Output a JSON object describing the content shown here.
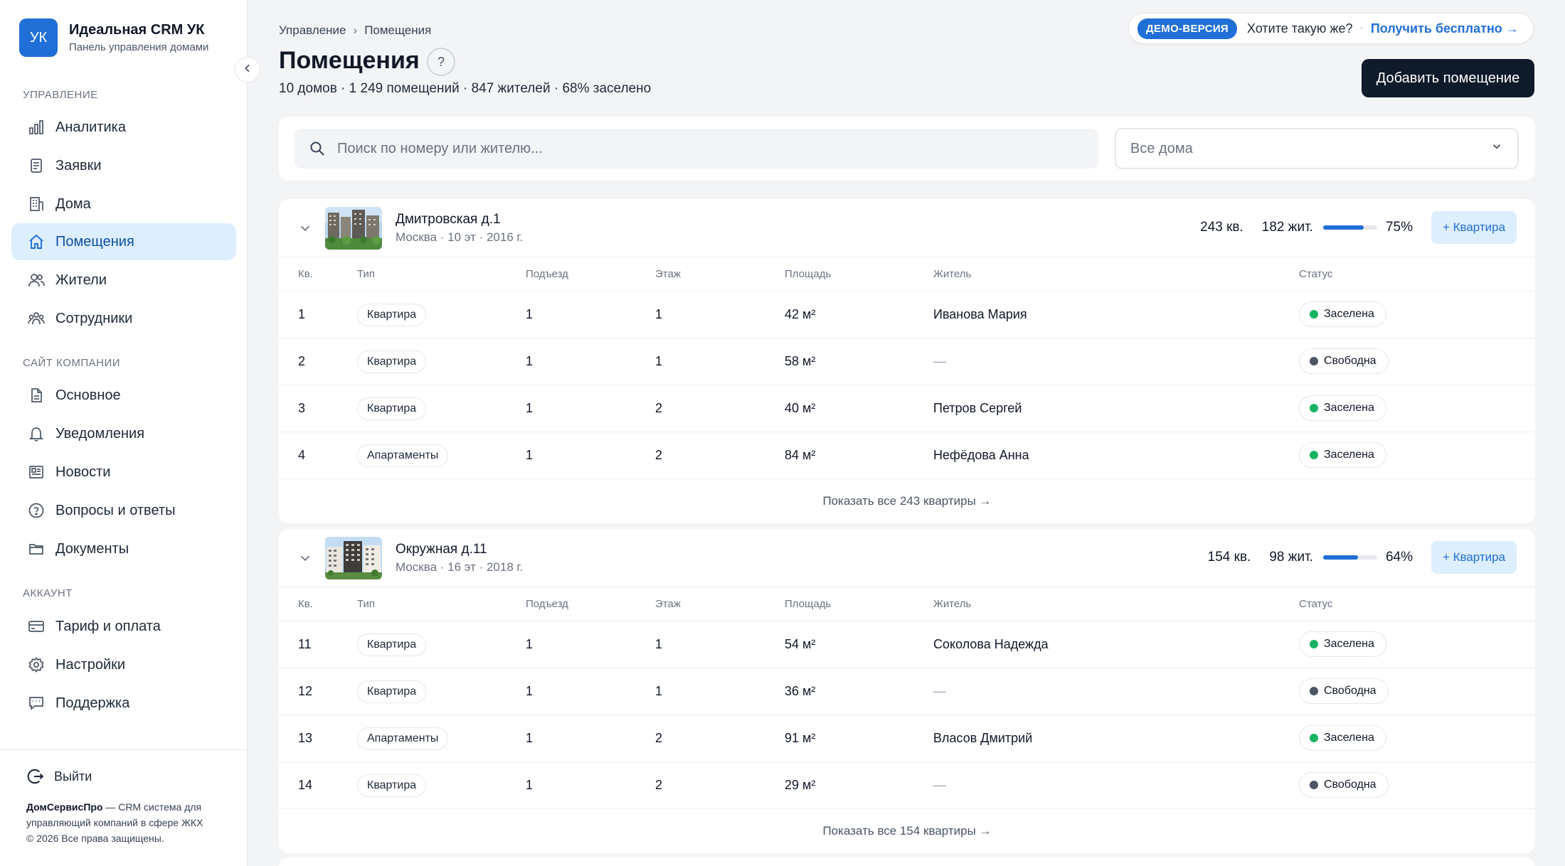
{
  "brand": {
    "logo": "УК",
    "title": "Идеальная CRM УК",
    "subtitle": "Панель управления домами"
  },
  "sidebar": {
    "sections": [
      {
        "title": "Управление",
        "items": [
          {
            "label": "Аналитика",
            "icon": "chart-icon"
          },
          {
            "label": "Заявки",
            "icon": "requests-icon"
          },
          {
            "label": "Дома",
            "icon": "building-icon"
          },
          {
            "label": "Помещения",
            "icon": "home-icon",
            "active": true
          },
          {
            "label": "Жители",
            "icon": "users-icon"
          },
          {
            "label": "Сотрудники",
            "icon": "team-icon"
          }
        ]
      },
      {
        "title": "Сайт компании",
        "items": [
          {
            "label": "Основное",
            "icon": "document-icon"
          },
          {
            "label": "Уведомления",
            "icon": "bell-icon"
          },
          {
            "label": "Новости",
            "icon": "news-icon"
          },
          {
            "label": "Вопросы и ответы",
            "icon": "question-icon"
          },
          {
            "label": "Документы",
            "icon": "folder-icon"
          }
        ]
      },
      {
        "title": "Аккаунт",
        "items": [
          {
            "label": "Тариф и оплата",
            "icon": "card-icon"
          },
          {
            "label": "Настройки",
            "icon": "gear-icon"
          },
          {
            "label": "Поддержка",
            "icon": "chat-icon"
          }
        ]
      }
    ],
    "logout": "Выйти",
    "footer": {
      "company": "ДомСервисПро",
      "text": " — CRM система для управляющий компаний в сфере ЖКХ",
      "copyright": "© 2026 Все права защищены."
    }
  },
  "breadcrumb": {
    "root": "Управление",
    "sep": "›",
    "current": "Помещения"
  },
  "page": {
    "title": "Помещения",
    "help": "?",
    "subtitle": "10 домов · 1 249 помещений · 847 жителей · 68% заселено"
  },
  "demo": {
    "badge": "ДЕМО-ВЕРСИЯ",
    "text": "Хотите такую же?",
    "dot": "·",
    "link": "Получить бесплатно →"
  },
  "add_button": "Добавить помещение",
  "search": {
    "placeholder": "Поиск по номеру или жителю..."
  },
  "select": {
    "value": "Все дома"
  },
  "columns": {
    "kv": "Кв.",
    "type": "Тип",
    "entrance": "Подъезд",
    "floor": "Этаж",
    "area": "Площадь",
    "resident": "Житель",
    "status": "Статус"
  },
  "colors": {
    "accent": "#1f6fd6",
    "occupied": "#16b364",
    "free": "#4b5563"
  },
  "houses": [
    {
      "name": "Дмитровская д.1",
      "meta": "Москва · 10 эт · 2016 г.",
      "units": "243 кв.",
      "residents": "182 жит.",
      "occupancy": 75,
      "occupancy_label": "75%",
      "add_label": "+ Квартира",
      "rows": [
        {
          "kv": "1",
          "type": "Квартира",
          "entrance": "1",
          "floor": "1",
          "area": "42 м²",
          "resident": "Иванова Мария",
          "status": "Заселена",
          "occupied": true
        },
        {
          "kv": "2",
          "type": "Квартира",
          "entrance": "1",
          "floor": "1",
          "area": "58 м²",
          "resident": "—",
          "status": "Свободна",
          "occupied": false
        },
        {
          "kv": "3",
          "type": "Квартира",
          "entrance": "1",
          "floor": "2",
          "area": "40 м²",
          "resident": "Петров Сергей",
          "status": "Заселена",
          "occupied": true
        },
        {
          "kv": "4",
          "type": "Апартаменты",
          "entrance": "1",
          "floor": "2",
          "area": "84 м²",
          "resident": "Нефёдова Анна",
          "status": "Заселена",
          "occupied": true
        }
      ],
      "show_all": "Показать все 243 квартиры →"
    },
    {
      "name": "Окружная д.11",
      "meta": "Москва · 16 эт · 2018 г.",
      "units": "154 кв.",
      "residents": "98 жит.",
      "occupancy": 64,
      "occupancy_label": "64%",
      "add_label": "+ Квартира",
      "rows": [
        {
          "kv": "11",
          "type": "Квартира",
          "entrance": "1",
          "floor": "1",
          "area": "54 м²",
          "resident": "Соколова Надежда",
          "status": "Заселена",
          "occupied": true
        },
        {
          "kv": "12",
          "type": "Квартира",
          "entrance": "1",
          "floor": "1",
          "area": "36 м²",
          "resident": "—",
          "status": "Свободна",
          "occupied": false
        },
        {
          "kv": "13",
          "type": "Апартаменты",
          "entrance": "1",
          "floor": "2",
          "area": "91 м²",
          "resident": "Власов Дмитрий",
          "status": "Заселена",
          "occupied": true
        },
        {
          "kv": "14",
          "type": "Квартира",
          "entrance": "1",
          "floor": "2",
          "area": "29 м²",
          "resident": "—",
          "status": "Свободна",
          "occupied": false
        }
      ],
      "show_all": "Показать все 154 квартиры →"
    }
  ]
}
